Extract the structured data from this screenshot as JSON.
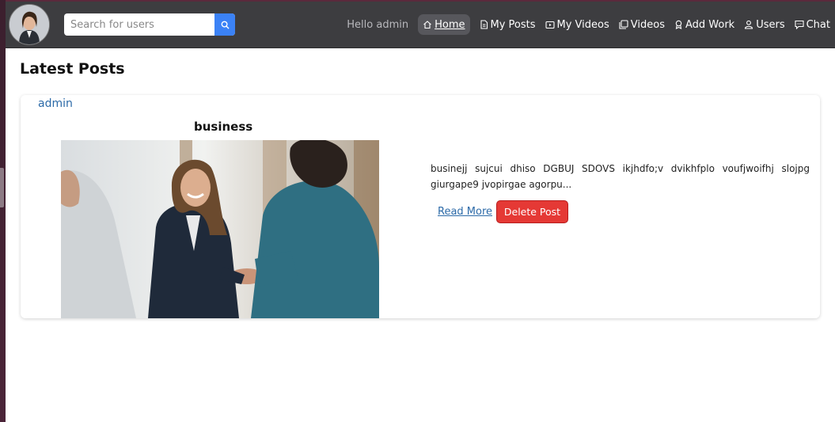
{
  "navbar": {
    "search_placeholder": "Search for users",
    "greeting": "Hello admin",
    "links": [
      {
        "label": "Home",
        "icon": "home-icon"
      },
      {
        "label": "My Posts",
        "icon": "document-icon"
      },
      {
        "label": "My Videos",
        "icon": "video-icon"
      },
      {
        "label": "Videos",
        "icon": "videos-icon"
      },
      {
        "label": "Add Work",
        "icon": "badge-icon"
      },
      {
        "label": "Users",
        "icon": "users-icon"
      },
      {
        "label": "Chat",
        "icon": "chat-icon"
      }
    ]
  },
  "main": {
    "heading": "Latest Posts",
    "posts": [
      {
        "author": "admin",
        "title": "business",
        "excerpt": "businejj sujcui dhiso DGBUJ SDOVS ikjhdfo;v dvikhfplo voufjwoifhj slojpg giurgape9 jvopirgae agorpu...",
        "read_more_label": "Read More",
        "delete_label": "Delete Post"
      }
    ]
  },
  "colors": {
    "navbar_bg": "#3d3d40",
    "search_button": "#3b82f6",
    "link": "#2c6aa8",
    "delete_button": "#e53935"
  }
}
